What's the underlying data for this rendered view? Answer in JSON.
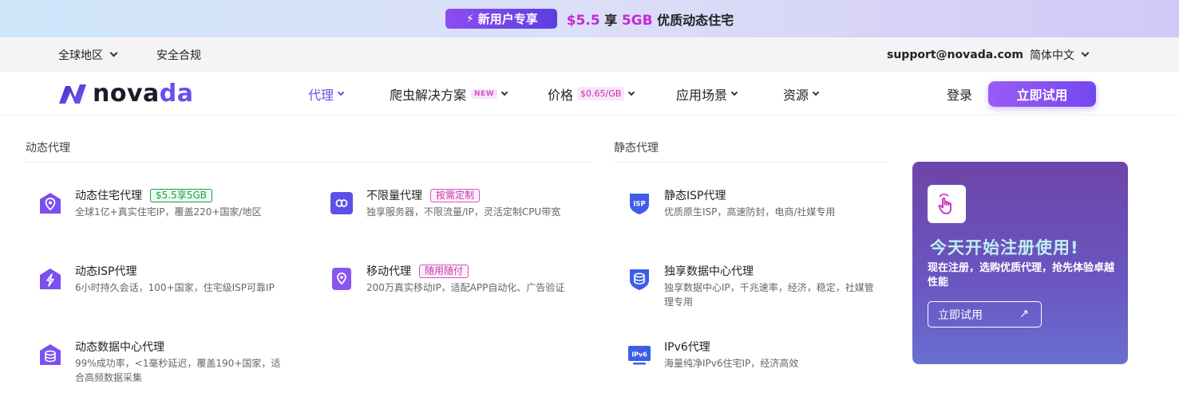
{
  "promo": {
    "badge": "新用户专享",
    "price": "$5.5",
    "mid": " 享 ",
    "amount": "5GB",
    "rest": " 优质动态住宅"
  },
  "util": {
    "region": "全球地区",
    "compliance": "安全合规",
    "email": "support@novada.com",
    "language": "简体中文"
  },
  "nav": {
    "logo": {
      "prefix": "nova",
      "accent": "da"
    },
    "proxy": "代理",
    "scraper": "爬虫解决方案",
    "scraper_tag": "NEW",
    "pricing": "价格",
    "pricing_tag": "$0.65/GB",
    "scenarios": "应用场景",
    "resources": "资源",
    "login": "登录",
    "try": "立即试用"
  },
  "dynamic": {
    "title": "动态代理",
    "items": [
      {
        "title": "动态住宅代理",
        "tag": "$5.5享5GB",
        "desc": "全球1亿+真实住宅IP，覆盖220+国家/地区"
      },
      {
        "title": "不限量代理",
        "tag": "按需定制",
        "desc": "独享服务器，不限流量/IP，灵活定制CPU带宽"
      },
      {
        "title": "动态ISP代理",
        "desc": "6小时持久会话，100+国家，住宅级ISP可靠IP"
      },
      {
        "title": "移动代理",
        "tag": "随用随付",
        "desc": "200万真实移动IP，适配APP自动化、广告验证"
      },
      {
        "title": "动态数据中心代理",
        "desc": "99%成功率，<1毫秒延迟，覆盖190+国家，适合高频数据采集"
      }
    ]
  },
  "static": {
    "title": "静态代理",
    "items": [
      {
        "title": "静态ISP代理",
        "desc": "优质原生ISP，高速防封，电商/社媒专用",
        "icon_text": "ISP"
      },
      {
        "title": "独享数据中心代理",
        "desc": "独享数据中心IP，千兆速率，经济，稳定，社媒管理专用"
      },
      {
        "title": "IPv6代理",
        "desc": "海量纯净IPv6住宅IP，经济高效",
        "icon_text": "IPv6"
      }
    ]
  },
  "side": {
    "title": "今天开始注册使用!",
    "desc": "现在注册，选购优质代理，抢先体验卓越性能",
    "button": "立即试用",
    "arrow": "↗"
  },
  "icons": {
    "chevron": "chevron-down-icon",
    "bolt": "lightning-icon",
    "hand": "tap-hand-icon"
  },
  "colors": {
    "brand": "#6c4cf0",
    "tag_green": "#19a04a",
    "tag_pink": "#c23aa8",
    "side_title": "#bff0ef"
  }
}
